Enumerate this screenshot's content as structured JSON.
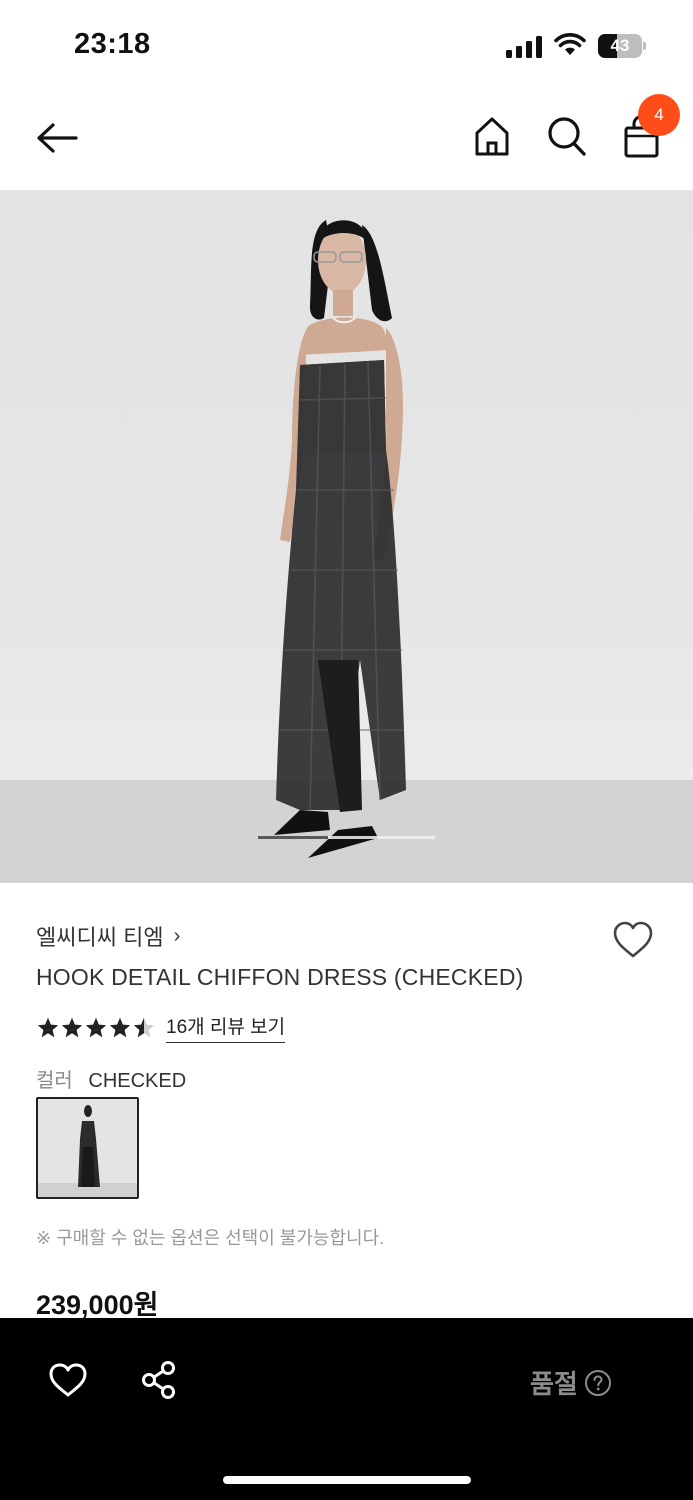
{
  "status_bar": {
    "time": "23:18",
    "battery": "43",
    "battery_level": 0.43
  },
  "header": {
    "cart_count": "4"
  },
  "product": {
    "brand": "엘씨디씨 티엠",
    "brand_chevron": "›",
    "name": "HOOK DETAIL CHIFFON DRESS (CHECKED)",
    "rating": 4.5,
    "rating_max": 5,
    "review_link": "16개 리뷰 보기",
    "color_label": "컬러",
    "color_value": "CHECKED",
    "notice": "※ 구매할 수 없는 옵션은 선택이 불가능합니다.",
    "price": "239,000원"
  },
  "gallery": {
    "position_fraction": 0.0
  },
  "bottom_bar": {
    "soldout_label": "품절"
  },
  "colors": {
    "badge": "#ff4d1a",
    "bottom_bar": "#000000",
    "soldout": "#8c8c8c"
  },
  "icons": [
    "back-arrow-icon",
    "home-icon",
    "search-icon",
    "shopping-bag-icon",
    "chevron-right-icon",
    "heart-icon",
    "star-icon",
    "share-icon",
    "help-circle-icon"
  ]
}
